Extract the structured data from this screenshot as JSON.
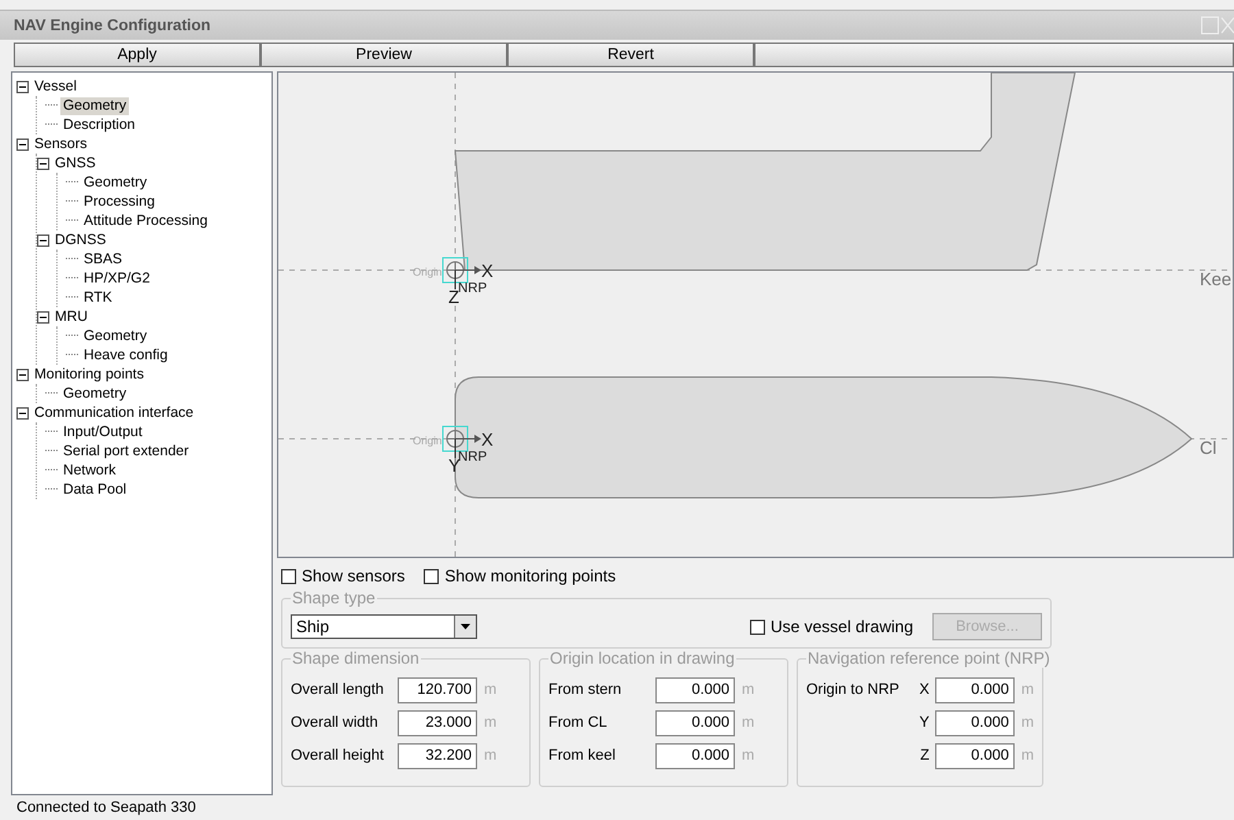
{
  "window": {
    "title": "NAV Engine Configuration"
  },
  "toolbar": [
    "Apply",
    "Preview",
    "Revert"
  ],
  "tree": [
    {
      "label": "Vessel",
      "expanded": true,
      "selected": false,
      "children": [
        {
          "label": "Geometry",
          "selected": true
        },
        {
          "label": "Description",
          "selected": false
        }
      ]
    },
    {
      "label": "Sensors",
      "expanded": true,
      "selected": false,
      "children": [
        {
          "label": "GNSS",
          "expanded": true,
          "selected": false,
          "children": [
            {
              "label": "Geometry",
              "selected": false
            },
            {
              "label": "Processing",
              "selected": false
            },
            {
              "label": "Attitude Processing",
              "selected": false
            }
          ]
        },
        {
          "label": "DGNSS",
          "expanded": true,
          "selected": false,
          "children": [
            {
              "label": "SBAS",
              "selected": false
            },
            {
              "label": "HP/XP/G2",
              "selected": false
            },
            {
              "label": "RTK",
              "selected": false
            }
          ]
        },
        {
          "label": "MRU",
          "expanded": true,
          "selected": false,
          "children": [
            {
              "label": "Geometry",
              "selected": false
            },
            {
              "label": "Heave config",
              "selected": false
            }
          ]
        }
      ]
    },
    {
      "label": "Monitoring points",
      "expanded": true,
      "selected": false,
      "children": [
        {
          "label": "Geometry",
          "selected": false
        }
      ]
    },
    {
      "label": "Communication interface",
      "expanded": true,
      "selected": false,
      "children": [
        {
          "label": "Input/Output",
          "selected": false
        },
        {
          "label": "Serial port extender",
          "selected": false
        },
        {
          "label": "Network",
          "selected": false
        },
        {
          "label": "Data Pool",
          "selected": false
        }
      ]
    }
  ],
  "drawing": {
    "views": [
      {
        "kind": "side",
        "origin_label": "Origin",
        "nrp_label": "NRP",
        "x_label": "X",
        "v_label": "Z",
        "line_label": "Kee"
      },
      {
        "kind": "top",
        "origin_label": "Origin",
        "nrp_label": "NRP",
        "x_label": "X",
        "v_label": "Y",
        "line_label": "Cl"
      }
    ]
  },
  "view_options": [
    {
      "label": "Show sensors",
      "checked": false
    },
    {
      "label": "Show monitoring points",
      "checked": false
    }
  ],
  "shape_type": {
    "legend": "Shape type",
    "value": "Ship",
    "use_vessel_drawing": {
      "label": "Use vessel drawing",
      "checked": false
    },
    "browse": {
      "label": "Browse...",
      "disabled": true
    }
  },
  "groups": [
    {
      "legend": "Shape dimension",
      "fields": [
        {
          "label": "Overall length",
          "value": "120.700",
          "unit": "m"
        },
        {
          "label": "Overall width",
          "value": "23.000",
          "unit": "m"
        },
        {
          "label": "Overall height",
          "value": "32.200",
          "unit": "m"
        }
      ]
    },
    {
      "legend": "Origin location in drawing",
      "fields": [
        {
          "label": "From stern",
          "value": "0.000",
          "unit": "m"
        },
        {
          "label": "From CL",
          "value": "0.000",
          "unit": "m"
        },
        {
          "label": "From keel",
          "value": "0.000",
          "unit": "m"
        }
      ]
    },
    {
      "legend": "Navigation reference point (NRP)",
      "row_label": "Origin to NRP",
      "fields": [
        {
          "label": "X",
          "value": "0.000",
          "unit": "m"
        },
        {
          "label": "Y",
          "value": "0.000",
          "unit": "m"
        },
        {
          "label": "Z",
          "value": "0.000",
          "unit": "m"
        }
      ]
    }
  ],
  "status_bar": "Connected to Seapath 330"
}
